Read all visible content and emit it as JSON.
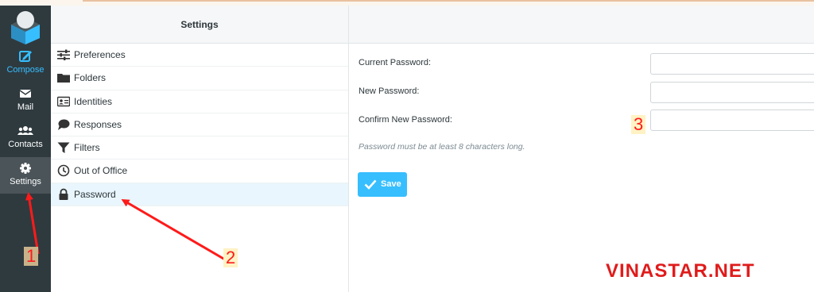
{
  "sidebar": {
    "items": [
      {
        "label": "Compose",
        "icon": "compose-icon"
      },
      {
        "label": "Mail",
        "icon": "mail-icon"
      },
      {
        "label": "Contacts",
        "icon": "contacts-icon"
      },
      {
        "label": "Settings",
        "icon": "gear-icon"
      }
    ]
  },
  "settings": {
    "title": "Settings",
    "items": [
      {
        "label": "Preferences",
        "icon": "sliders-icon"
      },
      {
        "label": "Folders",
        "icon": "folder-icon"
      },
      {
        "label": "Identities",
        "icon": "id-card-icon"
      },
      {
        "label": "Responses",
        "icon": "comment-icon"
      },
      {
        "label": "Filters",
        "icon": "filter-icon"
      },
      {
        "label": "Out of Office",
        "icon": "clock-icon"
      },
      {
        "label": "Password",
        "icon": "lock-icon"
      }
    ],
    "selected": "Password"
  },
  "password_form": {
    "current_label": "Current Password:",
    "current_value": "",
    "new_label": "New Password:",
    "new_value": "",
    "confirm_label": "Confirm New Password:",
    "confirm_value": "",
    "hint": "Password must be at least 8 characters long.",
    "save_label": "Save"
  },
  "annotations": {
    "step1": "1",
    "step2": "2",
    "step3": "3",
    "watermark": "VINASTAR.NET"
  },
  "colors": {
    "sidebar_bg": "#2f3a3f",
    "accent": "#37beff",
    "selected_row": "#e9f6fd",
    "annotation_red": "#ff1a1a"
  }
}
